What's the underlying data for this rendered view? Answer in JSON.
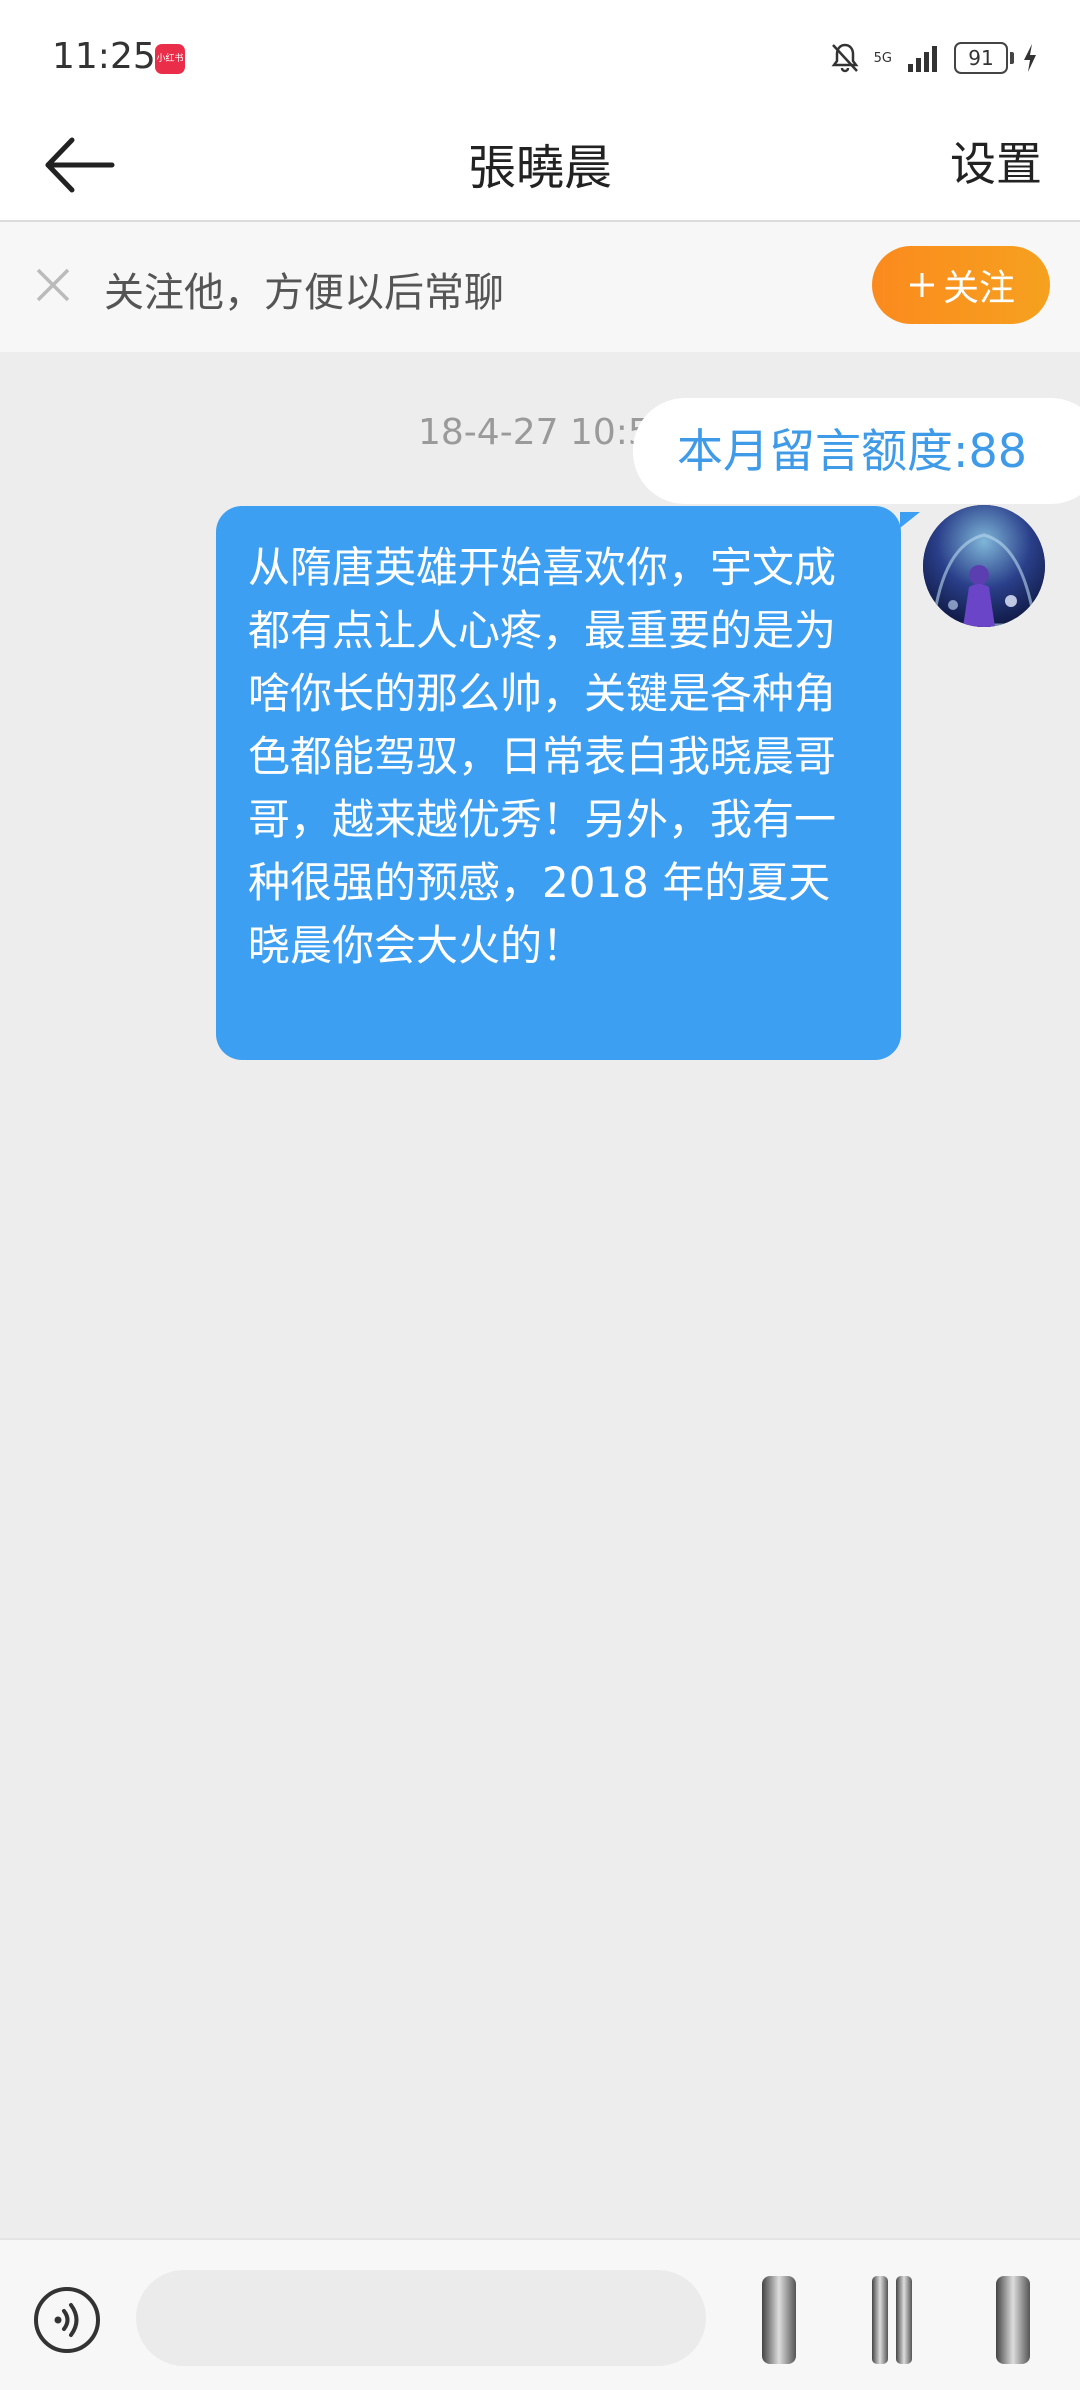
{
  "status_bar": {
    "time": "11:25",
    "app_icon_text": "小红书",
    "network": "5G",
    "battery": "91"
  },
  "header": {
    "title": "張曉晨",
    "settings_label": "设置"
  },
  "follow_bar": {
    "prompt": "关注他，方便以后常聊",
    "follow_label": "关注"
  },
  "chat": {
    "timestamp": "18-4-27 10:5",
    "quota": "本月留言额度:88",
    "message": "从隋唐英雄开始喜欢你，宇文成都有点让人心疼，最重要的是为啥你长的那么帅，关键是各种角色都能驾驭，日常表白我晓晨哥哥，越来越优秀！另外，我有一种很强的预感，2018 年的夏天晓晨你会大火的！"
  },
  "composer": {
    "placeholder": ""
  },
  "colors": {
    "accent": "#3d9ff1",
    "follow_orange": "#fb8a1e",
    "background": "#ededed"
  }
}
